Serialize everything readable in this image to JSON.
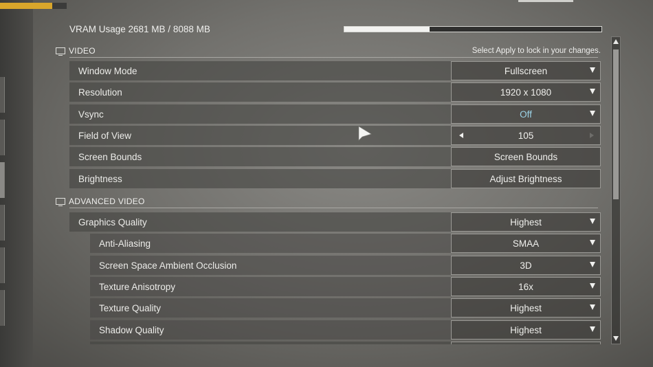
{
  "top_bar": {
    "progress": 0.78,
    "accent": "#d9a62b"
  },
  "vram": {
    "label": "VRAM Usage 2681 MB / 8088 MB",
    "used_mb": 2681,
    "total_mb": 8088
  },
  "video_section": {
    "title": "VIDEO",
    "icon": "monitor-icon",
    "hint": "Select Apply to lock in your changes.",
    "rows": [
      {
        "label": "Window Mode",
        "value": "Fullscreen",
        "control": "dropdown"
      },
      {
        "label": "Resolution",
        "value": "1920 x 1080",
        "control": "dropdown"
      },
      {
        "label": "Vsync",
        "value": "Off",
        "control": "dropdown",
        "highlight_color": "#9cd4e8"
      },
      {
        "label": "Field of View",
        "value": "105",
        "control": "stepper"
      },
      {
        "label": "Screen Bounds",
        "value": "Screen Bounds",
        "control": "button"
      },
      {
        "label": "Brightness",
        "value": "Adjust Brightness",
        "control": "button"
      }
    ]
  },
  "advanced_section": {
    "title": "ADVANCED VIDEO",
    "icon": "advanced-video-icon",
    "rows": [
      {
        "label": "Graphics Quality",
        "value": "Highest",
        "control": "dropdown",
        "indent": false
      },
      {
        "label": "Anti-Aliasing",
        "value": "SMAA",
        "control": "dropdown",
        "indent": true
      },
      {
        "label": "Screen Space Ambient Occlusion",
        "value": "3D",
        "control": "dropdown",
        "indent": true
      },
      {
        "label": "Texture Anisotropy",
        "value": "16x",
        "control": "dropdown",
        "indent": true
      },
      {
        "label": "Texture Quality",
        "value": "Highest",
        "control": "dropdown",
        "indent": true
      },
      {
        "label": "Shadow Quality",
        "value": "Highest",
        "control": "dropdown",
        "indent": true
      }
    ]
  },
  "scrollbar": {
    "position": 0.0,
    "visible_fraction": 0.49
  }
}
